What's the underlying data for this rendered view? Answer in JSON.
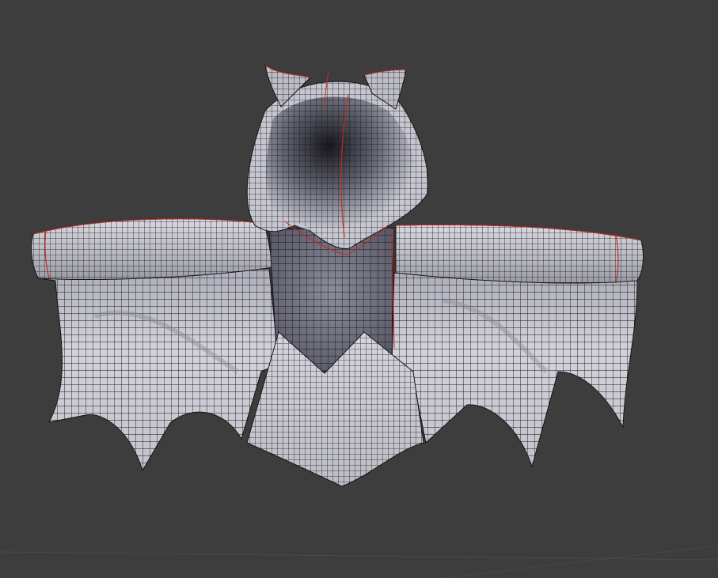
{
  "viewport": {
    "background_color": "#3d3d3d",
    "grid_line_color": "#4a4a4a",
    "mesh_fill_color": "#c4c4ce",
    "mesh_shadow_color": "#1c1c22",
    "wire_color": "#161616",
    "seam_color": "#c8281e"
  },
  "model": {
    "parts": [
      "hood",
      "left-ear",
      "right-ear",
      "left-sleeve",
      "right-sleeve",
      "left-wing",
      "right-wing",
      "torso",
      "front-panel"
    ]
  }
}
